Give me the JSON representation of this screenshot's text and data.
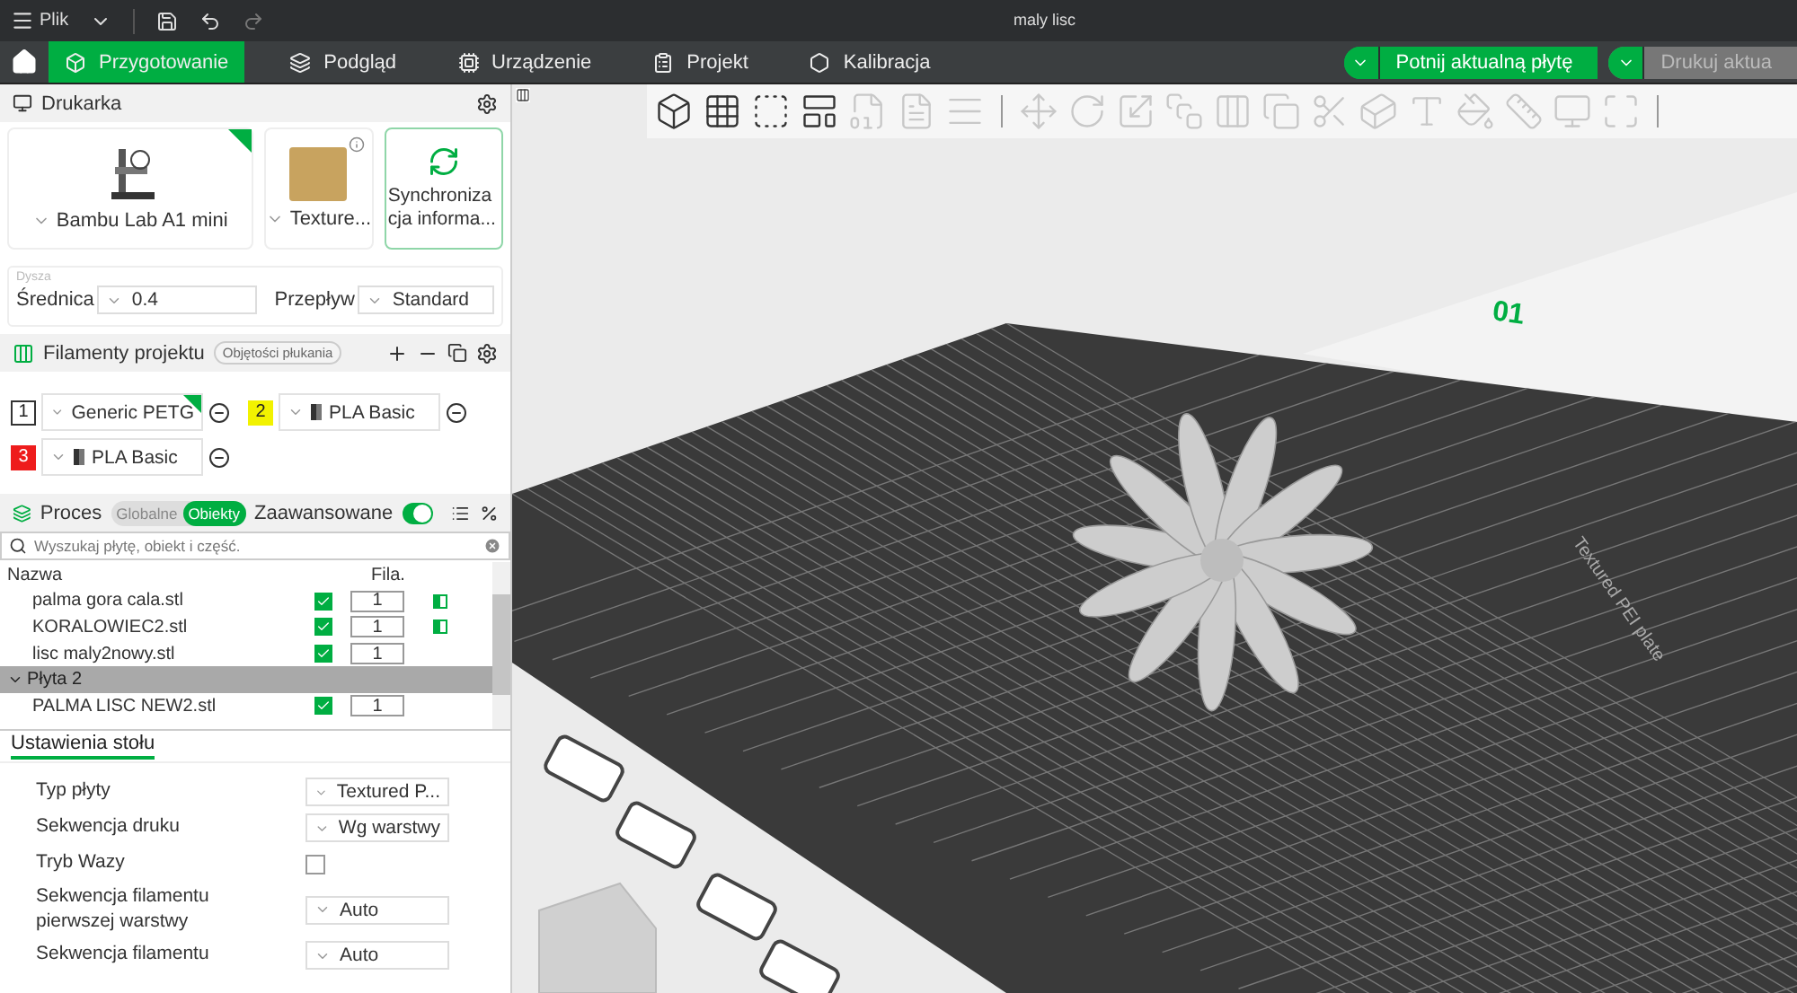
{
  "title_bar": {
    "menu": "Plik",
    "document_title": "maly lisc"
  },
  "tabs": [
    {
      "label": "Przygotowanie",
      "selected": true
    },
    {
      "label": "Podgląd",
      "selected": false
    },
    {
      "label": "Urządzenie",
      "selected": false
    },
    {
      "label": "Projekt",
      "selected": false
    },
    {
      "label": "Kalibracja",
      "selected": false
    }
  ],
  "actions": [
    {
      "label": "Potnij aktualną płytę",
      "disabled": false
    },
    {
      "label": "Drukuj aktua",
      "disabled": true
    }
  ],
  "printer": {
    "title": "Drukarka",
    "model": "Bambu Lab A1 mini",
    "plate": "Texture...",
    "sync": "Synchronizacja informa..."
  },
  "nozzle": {
    "title": "Dysza",
    "diameter_label": "Średnica",
    "diameter": "0.4",
    "flow_label": "Przepływ",
    "flow": "Standard"
  },
  "filaments": {
    "title": "Filamenty projektu",
    "flush_button": "Objętości płukania",
    "items": [
      {
        "number": "1",
        "name": "Generic PETG",
        "color": "#ffffff",
        "selected": true
      },
      {
        "number": "2",
        "name": "PLA Basic",
        "color": "#f2f200",
        "selected": false
      },
      {
        "number": "3",
        "name": "PLA Basic",
        "color": "#ee1c1c",
        "selected": false
      }
    ]
  },
  "process": {
    "title": "Proces",
    "modes": [
      {
        "label": "Globalne",
        "selected": false
      },
      {
        "label": "Obiekty",
        "selected": true
      }
    ],
    "advanced_label": "Zaawansowane",
    "advanced_on": true,
    "search_placeholder": "Wyszukaj płytę, obiekt i część."
  },
  "object_list": {
    "columns": [
      "Nazwa",
      "Fila."
    ],
    "rows": [
      {
        "kind": "object",
        "name": "palma gora cala.stl",
        "checked": true,
        "filament": "1",
        "has_settings": true,
        "selected": false
      },
      {
        "kind": "object",
        "name": "KORALOWIEC2.stl",
        "checked": true,
        "filament": "1",
        "has_settings": true,
        "selected": false
      },
      {
        "kind": "object",
        "name": "lisc maly2nowy.stl",
        "checked": true,
        "filament": "1",
        "has_settings": false,
        "selected": false
      },
      {
        "kind": "plate",
        "name": "Płyta 2",
        "expanded": true,
        "selected": true
      },
      {
        "kind": "object",
        "name": "PALMA LISC NEW2.stl",
        "checked": true,
        "filament": "1",
        "has_settings": false,
        "selected": false
      }
    ]
  },
  "plate_settings": {
    "tab": "Ustawienia stołu",
    "rows": [
      {
        "kind": "select",
        "label": "Typ płyty",
        "value": "Textured P..."
      },
      {
        "kind": "select",
        "label": "Sekwencja druku",
        "value": "Wg warstwy"
      },
      {
        "kind": "checkbox",
        "label": "Tryb Wazy",
        "checked": false
      },
      {
        "kind": "select",
        "label": "Sekwencja filamentu pierwszej warstwy",
        "value": "Auto"
      },
      {
        "kind": "select",
        "label": "Sekwencja filamentu",
        "value": "Auto"
      }
    ]
  },
  "viewport": {
    "plate_number": "01",
    "plate_label": "Textured PEI plate"
  }
}
